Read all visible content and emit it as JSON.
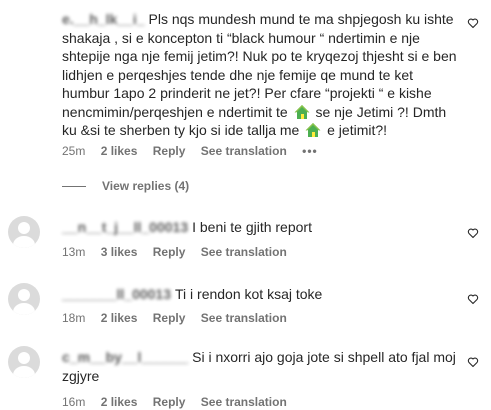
{
  "comments": [
    {
      "username": "e.__h_lk__i_",
      "segments": [
        "Pls nqs mundesh mund te ma shpjegosh ku ishte shakaja , si e koncepton ti “black humour “ ndertimin e nje shtepije nga nje femij jetim?! Nuk po te kryqezoj thjesht si e ben lidhjen e perqeshjes tende dhe nje femije qe mund te ket humbur 1apo 2 prinderit ne jet?! Per cfare “projekti “ e kishe nencmimin/perqeshjen e ndertimit te",
        "se nje Jetimi ?! Dmth ku &si te sherben ty kjo si ide tallja me",
        "e jetimit?!"
      ],
      "time": "25m",
      "likes": "2 likes",
      "reply": "Reply",
      "see_translation": "See translation",
      "more": "•••",
      "view_replies": "View replies (4)"
    },
    {
      "username": "__n__t_j__ll_00013",
      "text": "I beni te gjith report",
      "time": "13m",
      "likes": "3 likes",
      "reply": "Reply",
      "see_translation": "See translation"
    },
    {
      "username": "_______ll_00013",
      "text": "Ti i rendon kot ksaj toke",
      "time": "18m",
      "likes": "2 likes",
      "reply": "Reply",
      "see_translation": "See translation"
    },
    {
      "username": "c_m__by__l______",
      "text": "Si i nxorri ajo goja jote si shpell ato fjal moj zgjyre",
      "time": "16m",
      "likes": "2 likes",
      "reply": "Reply",
      "see_translation": "See translation"
    }
  ],
  "icons": {
    "like": "heart-outline-icon",
    "avatar": "default-avatar-icon",
    "emoji": "house-emoji-icon"
  },
  "colors": {
    "text": "#262626",
    "secondary": "#737373",
    "avatar_bg": "#dbdbdb"
  }
}
